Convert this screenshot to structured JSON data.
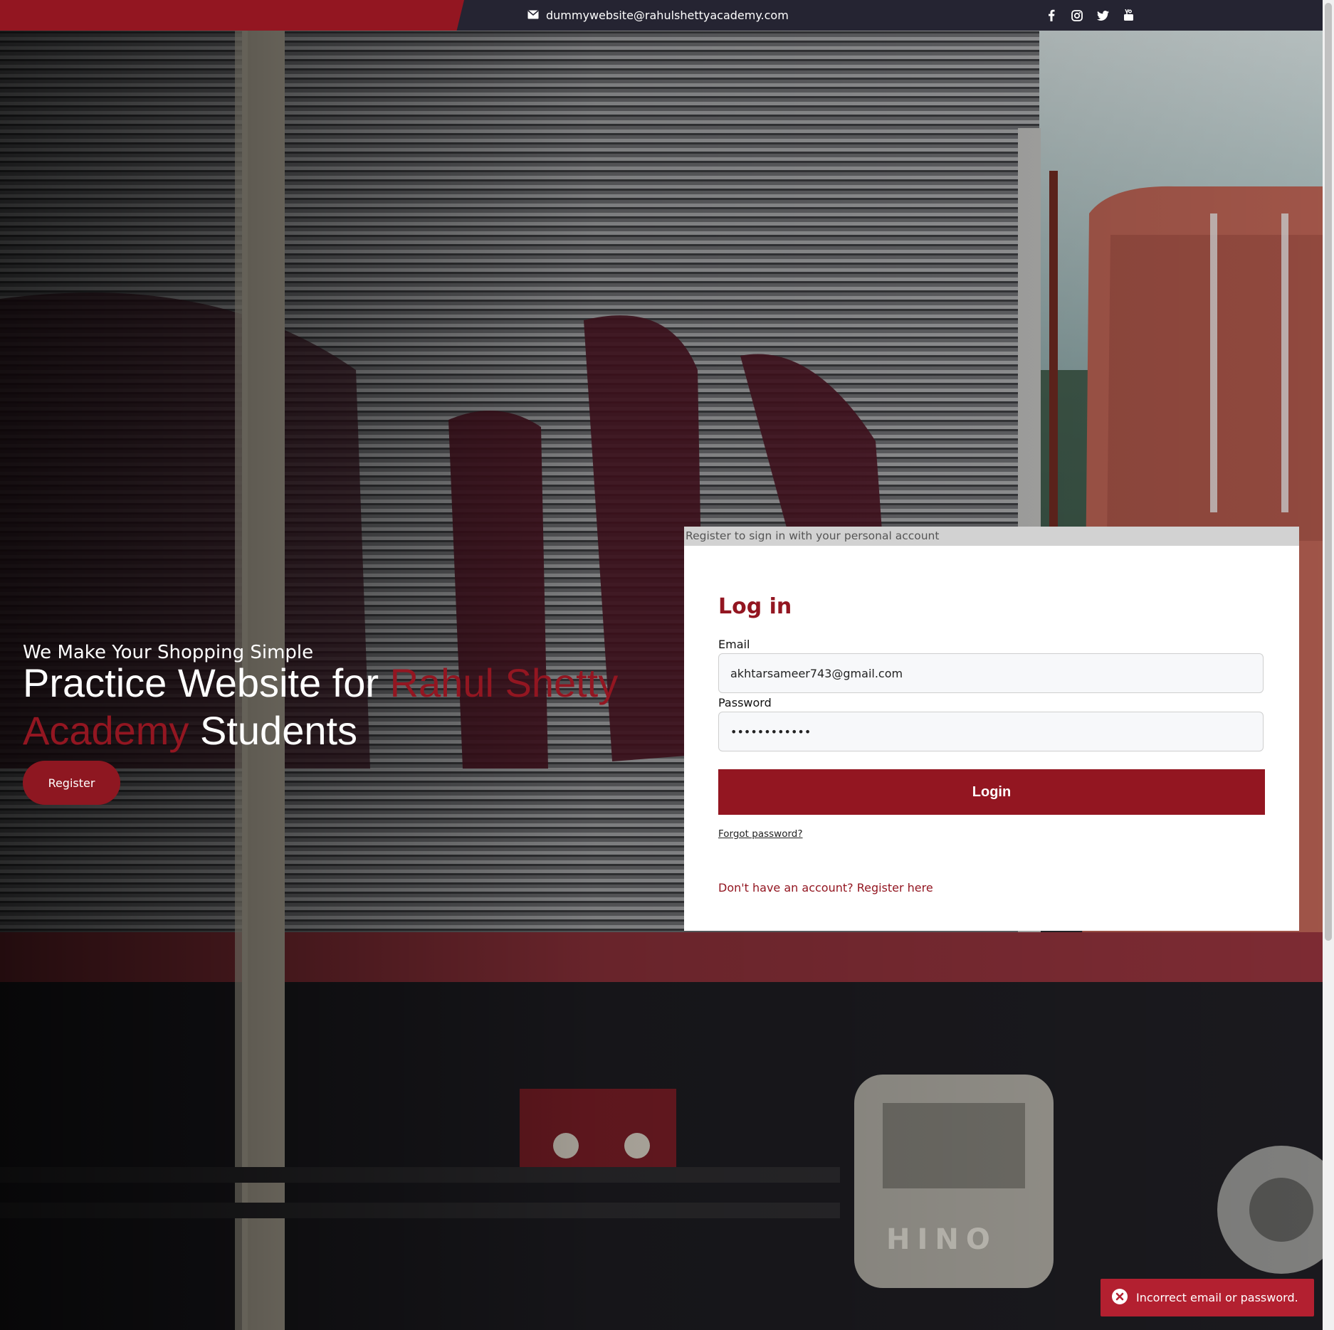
{
  "topbar": {
    "email": "dummywebsite@rahulshettyacademy.com",
    "social_icons": [
      "facebook-icon",
      "instagram-icon",
      "twitter-icon",
      "youtube-icon"
    ]
  },
  "hero": {
    "tagline": "We Make Your Shopping Simple",
    "headline_part1": "Practice Website for ",
    "headline_accent": "Rahul Shetty Academy",
    "headline_part2": " Students",
    "register_label": "Register"
  },
  "login_card": {
    "banner": "Register to sign in with your personal account",
    "title": "Log in",
    "email_label": "Email",
    "email_value": "akhtarsameer743@gmail.com",
    "password_label": "Password",
    "password_value": "••••••••••••",
    "login_label": "Login",
    "forgot_label": "Forgot password?",
    "register_link": "Don't have an account? Register here"
  },
  "toast": {
    "message": "Incorrect email or password."
  },
  "colors": {
    "brand_red": "#931621",
    "topbar_dark": "#252432",
    "toast_red": "#b32030"
  }
}
